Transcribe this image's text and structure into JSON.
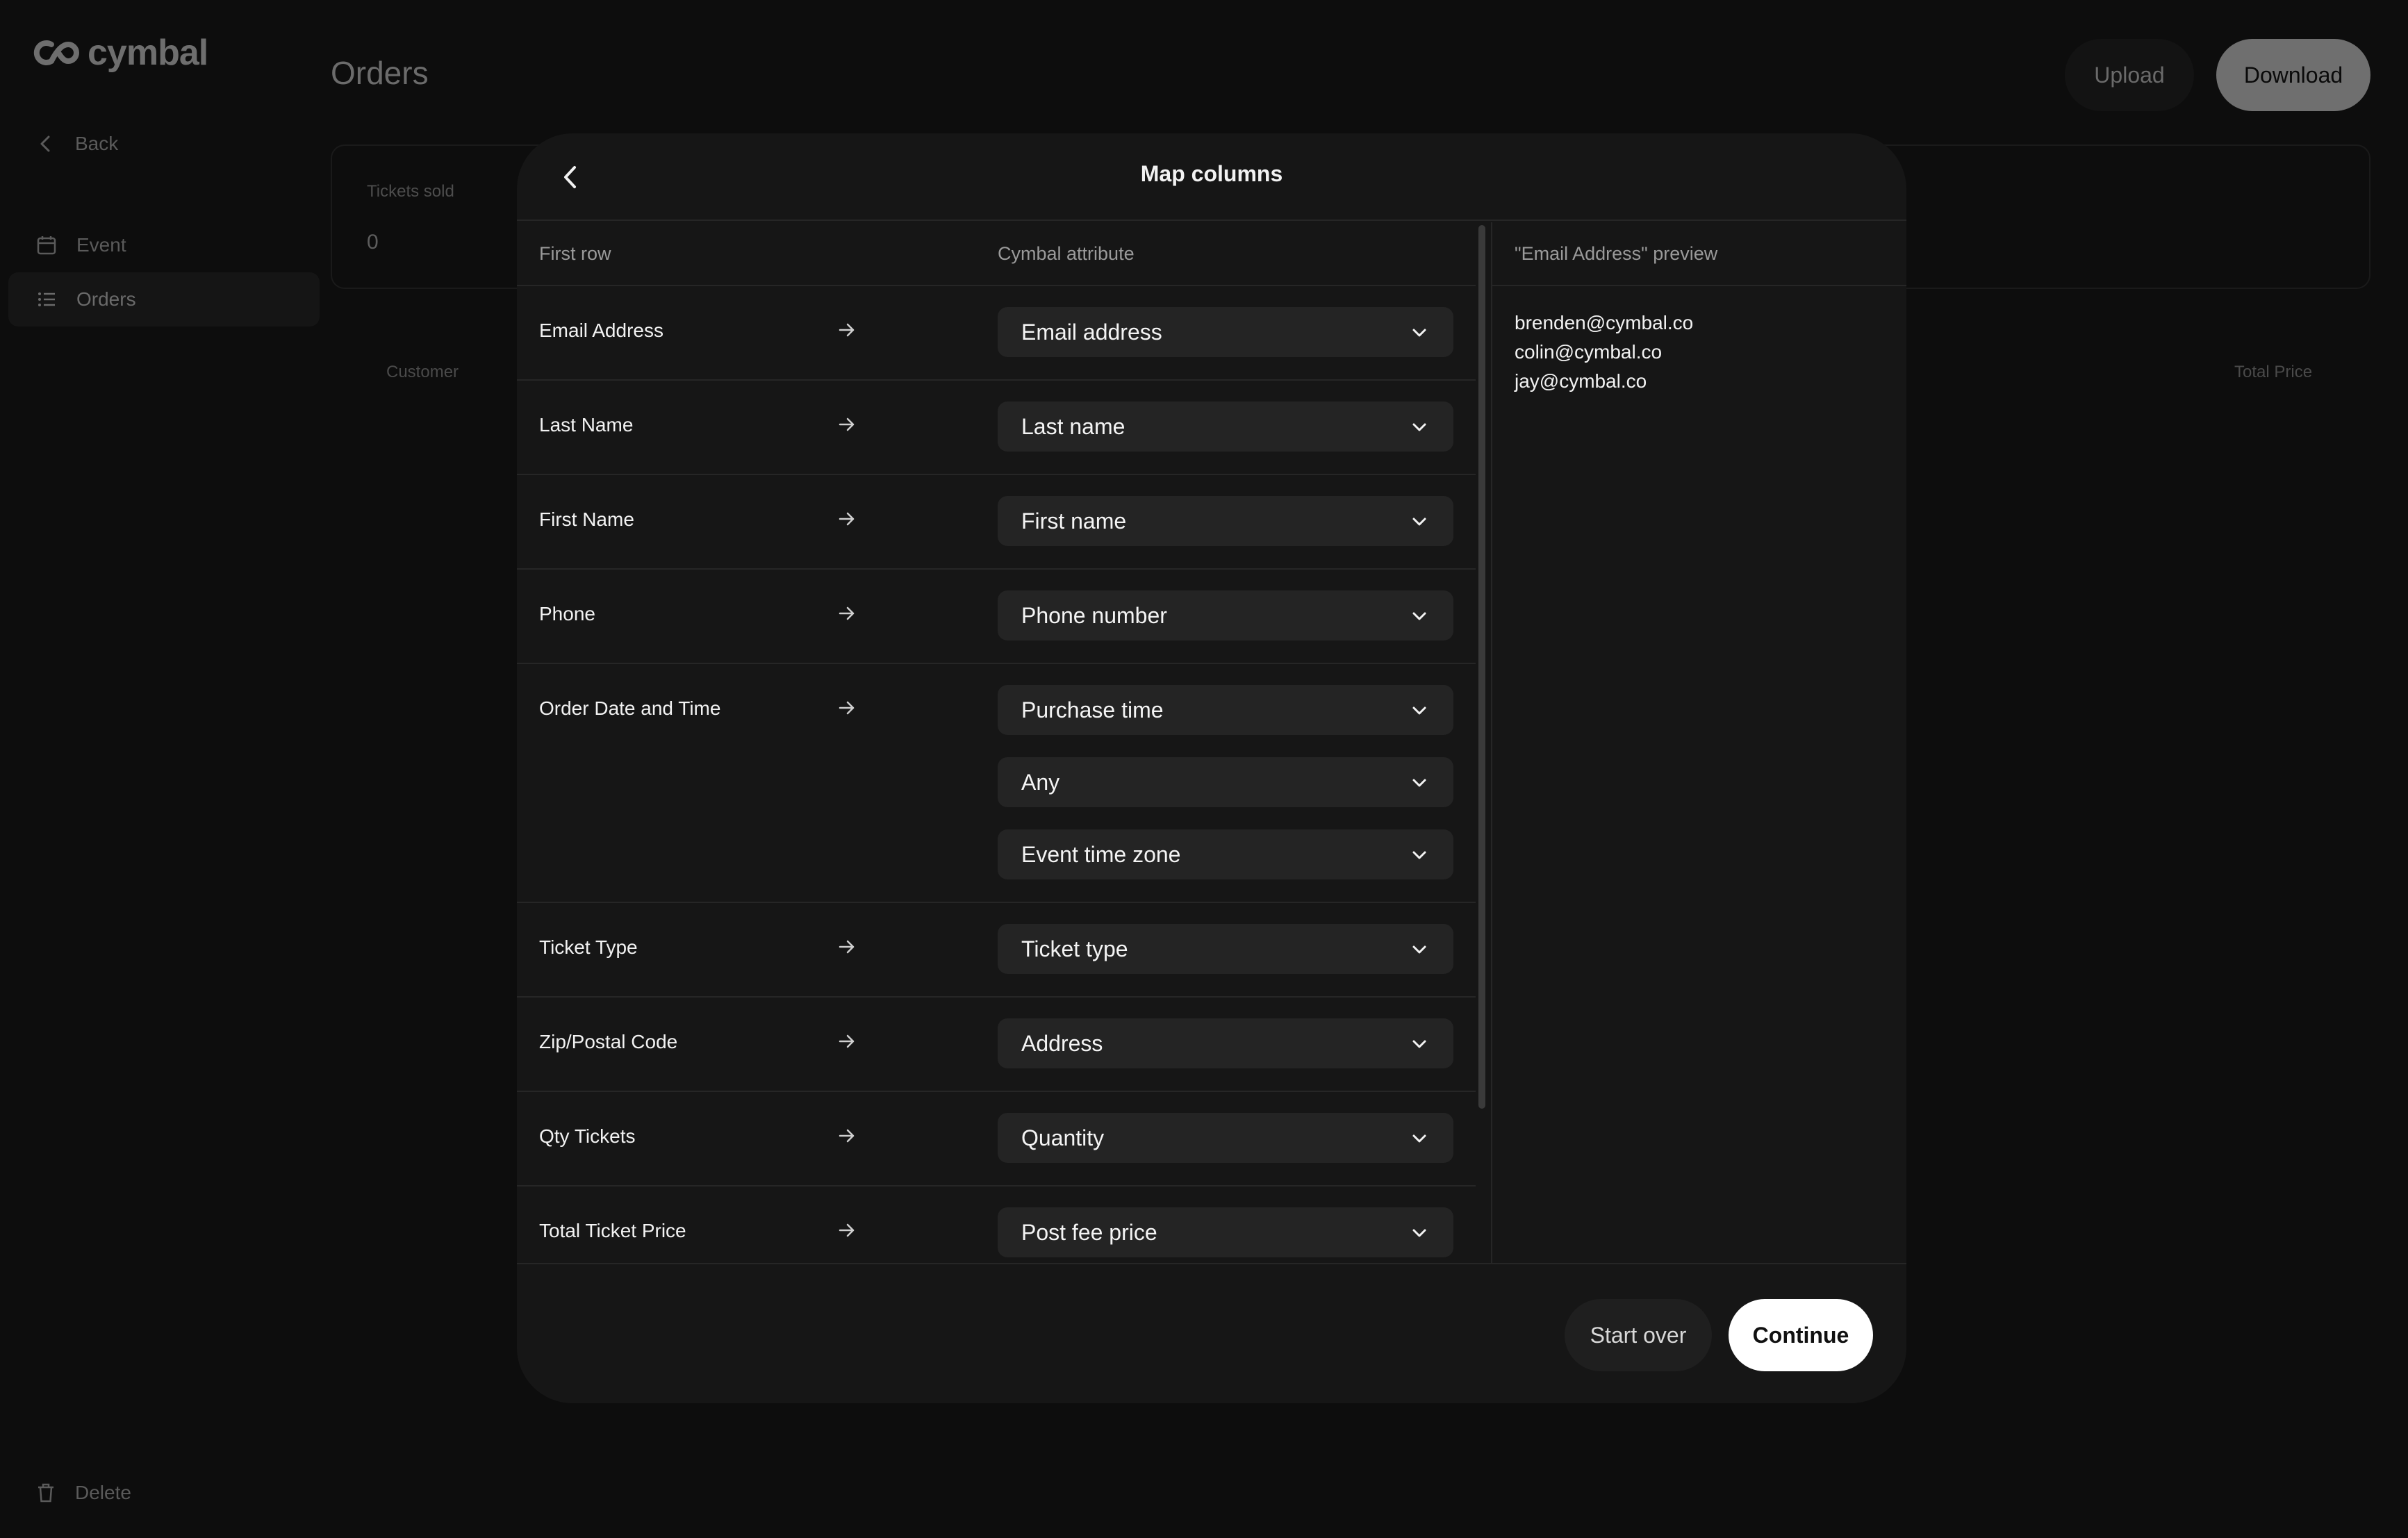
{
  "app": {
    "logo_text": "cymbal",
    "page_title": "Orders",
    "sidebar": {
      "back_label": "Back",
      "items": [
        {
          "label": "Event",
          "icon": "calendar-icon"
        },
        {
          "label": "Orders",
          "icon": "list-icon",
          "active": true
        }
      ],
      "delete_label": "Delete"
    },
    "header_buttons": {
      "upload": "Upload",
      "download": "Download"
    },
    "stats": {
      "tickets_sold_label": "Tickets sold",
      "tickets_sold_value": "0"
    },
    "table_columns": {
      "customer": "Customer",
      "total_price": "Total Price"
    }
  },
  "modal": {
    "title": "Map columns",
    "columns": {
      "first_row": "First row",
      "attribute": "Cymbal attribute"
    },
    "rows": [
      {
        "label": "Email Address",
        "selects": [
          "Email address"
        ]
      },
      {
        "label": "Last Name",
        "selects": [
          "Last name"
        ]
      },
      {
        "label": "First Name",
        "selects": [
          "First name"
        ]
      },
      {
        "label": "Phone",
        "selects": [
          "Phone number"
        ]
      },
      {
        "label": "Order Date and Time",
        "selects": [
          "Purchase time",
          "Any",
          "Event time zone"
        ]
      },
      {
        "label": "Ticket Type",
        "selects": [
          "Ticket type"
        ]
      },
      {
        "label": "Zip/Postal Code",
        "selects": [
          "Address"
        ]
      },
      {
        "label": "Qty Tickets",
        "selects": [
          "Quantity"
        ]
      },
      {
        "label": "Total Ticket Price",
        "selects": [
          "Post fee price"
        ]
      }
    ],
    "preview": {
      "title": "\"Email Address\" preview",
      "items": [
        "brenden@cymbal.co",
        "colin@cymbal.co",
        "jay@cymbal.co"
      ]
    },
    "footer": {
      "start_over": "Start over",
      "continue": "Continue"
    }
  },
  "colors": {
    "background": "#000000",
    "modal": "#161616",
    "select": "#242424",
    "primary_button": "#ffffff"
  }
}
